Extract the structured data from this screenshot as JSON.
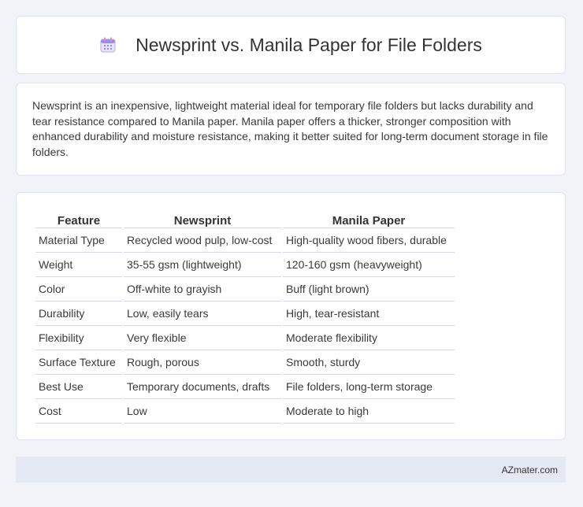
{
  "header": {
    "icon": "calendar-icon",
    "title": "Newsprint vs. Manila Paper for File Folders"
  },
  "intro": {
    "text": "Newsprint is an inexpensive, lightweight material ideal for temporary file folders but lacks durability and tear resistance compared to Manila paper. Manila paper offers a thicker, stronger composition with enhanced durability and moisture resistance, making it better suited for long-term document storage in file folders."
  },
  "table": {
    "headers": [
      "Feature",
      "Newsprint",
      "Manila Paper"
    ],
    "rows": [
      [
        "Material Type",
        "Recycled wood pulp, low-cost",
        "High-quality wood fibers, durable"
      ],
      [
        "Weight",
        "35-55 gsm (lightweight)",
        "120-160 gsm (heavyweight)"
      ],
      [
        "Color",
        "Off-white to grayish",
        "Buff (light brown)"
      ],
      [
        "Durability",
        "Low, easily tears",
        "High, tear-resistant"
      ],
      [
        "Flexibility",
        "Very flexible",
        "Moderate flexibility"
      ],
      [
        "Surface Texture",
        "Rough, porous",
        "Smooth, sturdy"
      ],
      [
        "Best Use",
        "Temporary documents, drafts",
        "File folders, long-term storage"
      ],
      [
        "Cost",
        "Low",
        "Moderate to high"
      ]
    ]
  },
  "footer": {
    "brand": "AZmater.com"
  },
  "colors": {
    "page_bg": "#f1f3f8",
    "card_bg": "#ffffff",
    "footer_bg": "#e3e8f3",
    "icon_accent": "#8b7fe0"
  }
}
